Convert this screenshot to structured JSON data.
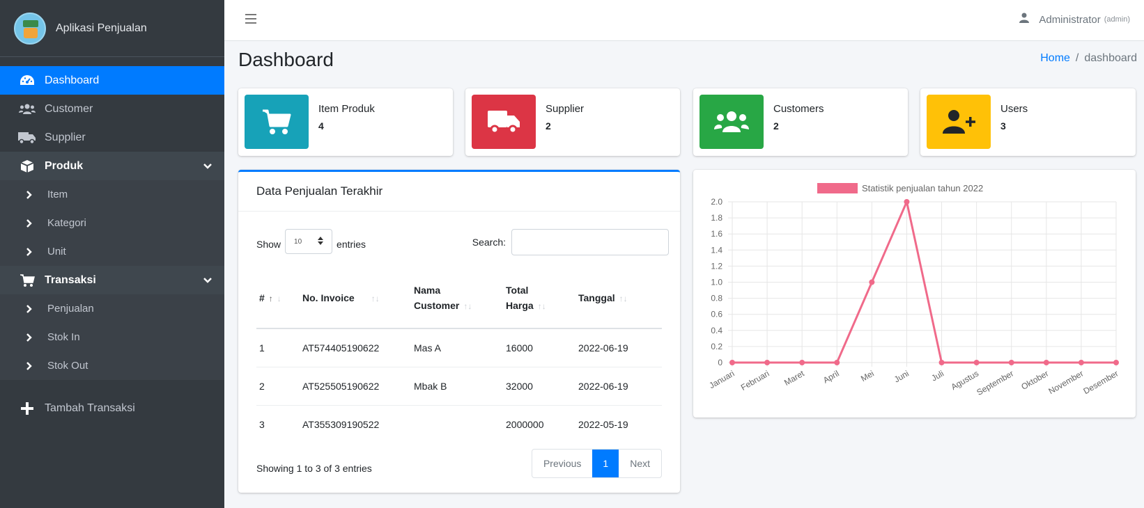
{
  "sidebar": {
    "brand": "Aplikasi Penjualan",
    "items": [
      {
        "label": "Dashboard",
        "icon": "tachometer-icon",
        "active": true
      },
      {
        "label": "Customer",
        "icon": "users-icon"
      },
      {
        "label": "Supplier",
        "icon": "truck-icon"
      },
      {
        "label": "Produk",
        "icon": "box-icon",
        "open": true,
        "children": [
          {
            "label": "Item"
          },
          {
            "label": "Kategori"
          },
          {
            "label": "Unit"
          }
        ]
      },
      {
        "label": "Transaksi",
        "icon": "cart-icon",
        "open": true,
        "children": [
          {
            "label": "Penjualan"
          },
          {
            "label": "Stok In"
          },
          {
            "label": "Stok Out"
          }
        ]
      },
      {
        "label": "Tambah Transaksi",
        "icon": "plus-icon"
      }
    ]
  },
  "topbar": {
    "user_name": "Administrator",
    "user_role": "(admin)"
  },
  "header": {
    "title": "Dashboard",
    "breadcrumb_home": "Home",
    "breadcrumb_sep": "/",
    "breadcrumb_current": "dashboard"
  },
  "info_boxes": [
    {
      "label": "Item Produk",
      "value": "4",
      "color": "#17a2b8",
      "icon": "shopping-cart-icon"
    },
    {
      "label": "Supplier",
      "value": "2",
      "color": "#dc3545",
      "icon": "truck-icon"
    },
    {
      "label": "Customers",
      "value": "2",
      "color": "#28a745",
      "icon": "users-icon"
    },
    {
      "label": "Users",
      "value": "3",
      "color": "#ffc107",
      "icon": "user-plus-icon"
    }
  ],
  "sales_table": {
    "title": "Data Penjualan Terakhir",
    "show_label": "Show",
    "entries_value": "10",
    "entries_label": "entries",
    "search_label": "Search:",
    "columns": [
      [
        "#"
      ],
      [
        "No. Invoice"
      ],
      [
        "Nama",
        "Customer"
      ],
      [
        "Total",
        "Harga"
      ],
      [
        "Tanggal"
      ]
    ],
    "rows": [
      [
        "1",
        "AT574405190622",
        "Mas A",
        "16000",
        "2022-06-19"
      ],
      [
        "2",
        "AT525505190622",
        "Mbak B",
        "32000",
        "2022-06-19"
      ],
      [
        "3",
        "AT355309190522",
        "",
        "2000000",
        "2022-05-19"
      ]
    ],
    "info": "Showing 1 to 3 of 3 entries",
    "prev_label": "Previous",
    "page_label": "1",
    "next_label": "Next"
  },
  "chart_data": {
    "type": "line",
    "title": "",
    "series": [
      {
        "name": "Statistik penjualan tahun 2022",
        "color": "#f06a8a",
        "values": [
          0,
          0,
          0,
          0,
          1,
          2,
          0,
          0,
          0,
          0,
          0,
          0
        ]
      }
    ],
    "categories": [
      "Januari",
      "Februari",
      "Maret",
      "April",
      "Mei",
      "Juni",
      "Juli",
      "Agustus",
      "September",
      "Oktober",
      "November",
      "Desember"
    ],
    "ylim": [
      0,
      2
    ],
    "yticks": [
      "0",
      "0.2",
      "0.4",
      "0.6",
      "0.8",
      "1.0",
      "1.2",
      "1.4",
      "1.6",
      "1.8",
      "2.0"
    ],
    "grid": true,
    "legend": "top"
  },
  "colors": {
    "sidebar_bg": "#343a40",
    "primary": "#007bff"
  }
}
